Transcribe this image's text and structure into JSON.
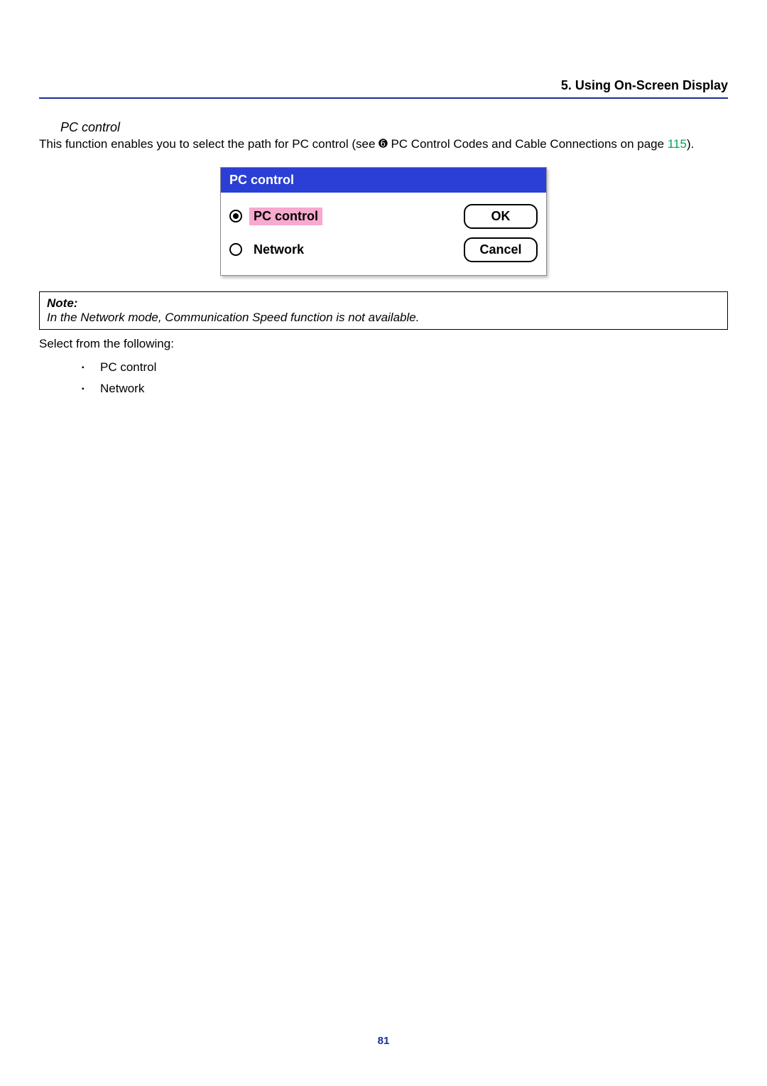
{
  "header": {
    "section": "5. Using On-Screen Display"
  },
  "subheading": "PC control",
  "intro": {
    "prefix": "This function enables you to select the path for PC control (see ",
    "ref_symbol": "➏",
    "ref_text": " PC Control Codes and Cable Connections on page ",
    "page_ref": "115",
    "suffix": ")."
  },
  "dialog": {
    "title": "PC control",
    "options": [
      {
        "label": "PC control",
        "selected": true
      },
      {
        "label": "Network",
        "selected": false
      }
    ],
    "buttons": {
      "ok": "OK",
      "cancel": "Cancel"
    }
  },
  "note": {
    "label": "Note:",
    "text": "In the Network mode, Communication Speed function is not available."
  },
  "select_from": "Select from the following:",
  "bullets": [
    "PC control",
    "Network"
  ],
  "page_number": "81"
}
